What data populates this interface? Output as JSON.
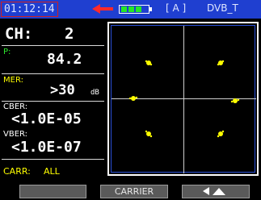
{
  "status_bar": {
    "time": "01:12:14",
    "mode": "[ A ]",
    "standard": "DVB_T",
    "battery_level": 0.75
  },
  "measurements": {
    "ch_label": "CH:",
    "ch_value": "2",
    "p_label": "P:",
    "p_value": "84.2",
    "mer_label": "MER:",
    "mer_value": ">30",
    "mer_unit": "dB",
    "cber_label": "CBER:",
    "cber_value": "<1.0E-05",
    "vber_label": "VBER:",
    "vber_value": "<1.0E-07",
    "carr_label": "CARR:",
    "carr_value": "ALL"
  },
  "softkeys": {
    "left": "",
    "center": "CARRIER",
    "right_icon": "up-down-arrows-icon"
  },
  "colors": {
    "status_bar": "#1f3fd0",
    "labels": "#ffff00",
    "constellation_points": "#ffff00"
  }
}
